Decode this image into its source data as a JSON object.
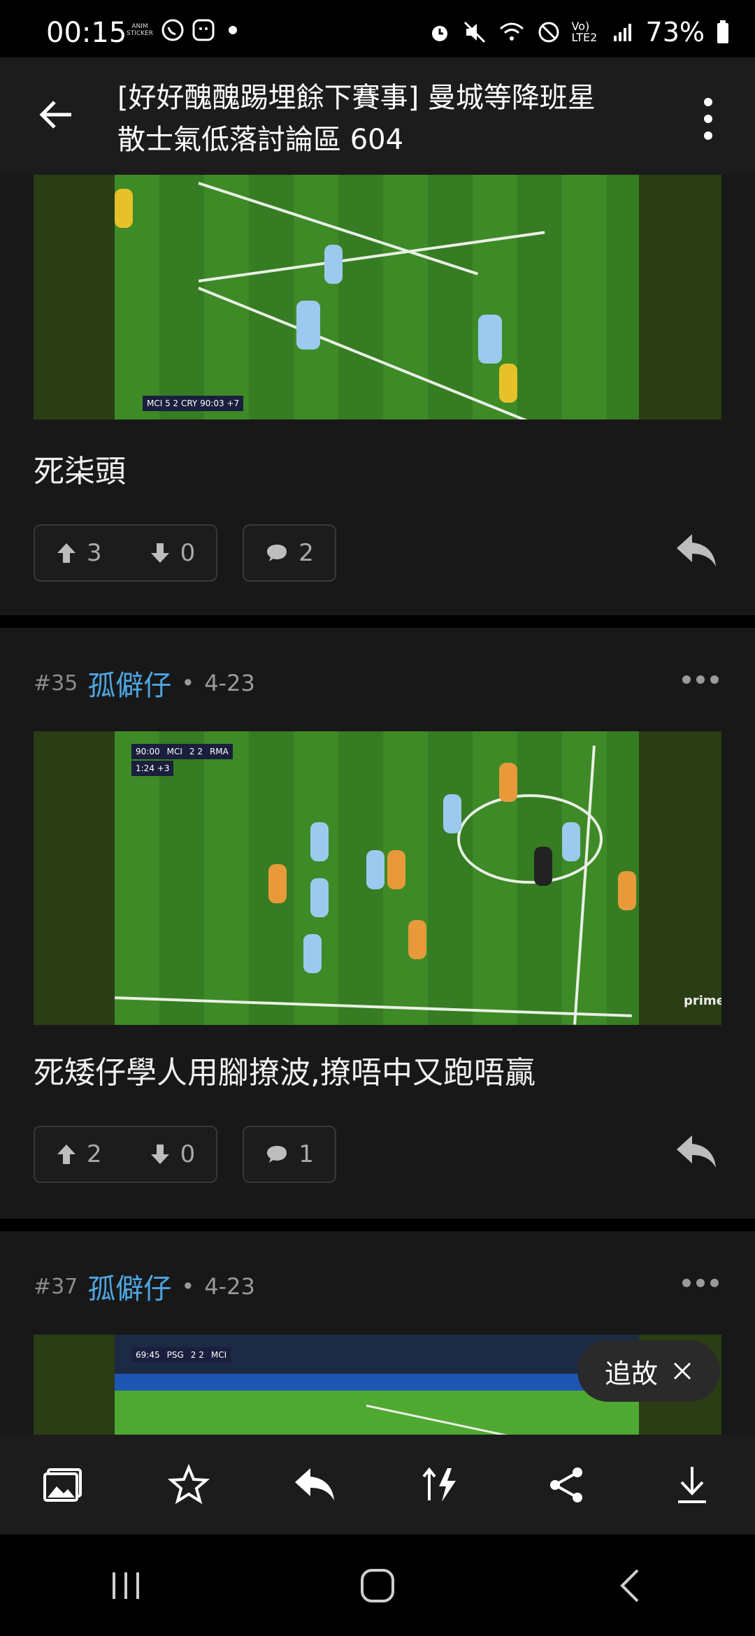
{
  "status_bar": {
    "time": "00:15",
    "sticker_label": "ANIM STICKER",
    "battery": "73%",
    "network": "Vo) LTE2"
  },
  "header": {
    "title": "[好好醜醜踢埋餘下賽事] 曼城等降班星散士氣低落討論區 604"
  },
  "posts": [
    {
      "text": "死柒頭",
      "upvotes": "3",
      "downvotes": "0",
      "comments": "2",
      "scorebug": "MCI 5 2 CRY 90:03 +7"
    },
    {
      "floor": "#35",
      "user": "孤僻仔",
      "date": "4-23",
      "text": "死矮仔學人用腳撩波,撩唔中又跑唔贏",
      "upvotes": "2",
      "downvotes": "0",
      "comments": "1",
      "scorebug_time": "90:00",
      "scorebug_home": "MCI",
      "scorebug_score": "2   2",
      "scorebug_away": "RMA",
      "scorebug_extra": "1:24 +3",
      "broadcaster": "prime"
    },
    {
      "floor": "#37",
      "user": "孤僻仔",
      "date": "4-23",
      "scorebug_time": "69:45",
      "scorebug_home": "PSG",
      "scorebug_score": "2   2",
      "scorebug_away": "MCI"
    }
  ],
  "follow_button": {
    "label": "追故"
  },
  "toolbar_icons": [
    "image-icon",
    "star-icon",
    "reply-icon",
    "sort-icon",
    "share-icon",
    "download-icon"
  ],
  "navbar_icons": [
    "recents-icon",
    "home-icon",
    "back-icon"
  ]
}
